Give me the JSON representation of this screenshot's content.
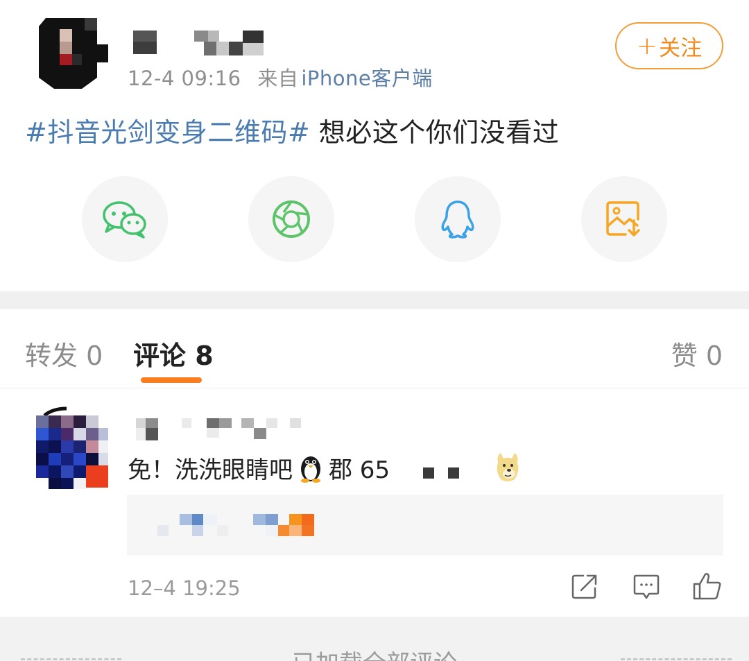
{
  "post": {
    "time": "12-4 09:16",
    "source_prefix": "来自",
    "source": "iPhone客户端",
    "follow_label": "关注",
    "follow_plus": "+",
    "topic": "#抖音光剑变身二维码#",
    "text": " 想必这个你们没看过",
    "share": [
      {
        "name": "wechat-icon",
        "color": "#43c26e"
      },
      {
        "name": "moments-icon",
        "color": "#5dc46a"
      },
      {
        "name": "qq-icon",
        "color": "#3ba2e6"
      },
      {
        "name": "save-image-icon",
        "color": "#f5a623"
      }
    ]
  },
  "tabs": {
    "repost": "转发 0",
    "comments": "评论 8",
    "likes": "赞 0",
    "accent": "#fa7d1e"
  },
  "comment": {
    "text_prefix": "免！洗洗眼睛吧",
    "text_mid": "郡 65",
    "time": "12–4 19:25"
  },
  "footer": {
    "text": "已加载全部评论"
  },
  "colors": {
    "link": "#4b7cb0",
    "follow": "#f08a1c",
    "muted": "#8f8f8f"
  }
}
